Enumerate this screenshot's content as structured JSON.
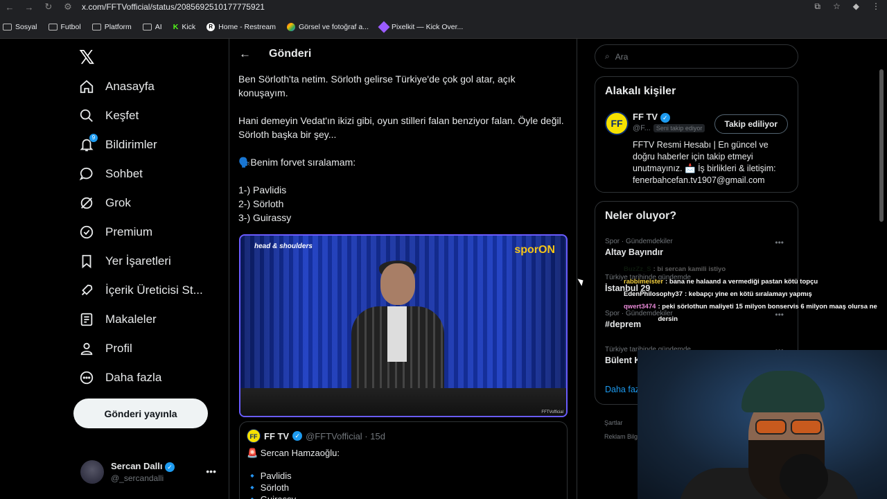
{
  "browser": {
    "url": "x.com/FFTVofficial/status/2085692510177775921",
    "bookmarks": [
      {
        "label": "Sosyal",
        "icon": "folder-icon"
      },
      {
        "label": "Futbol",
        "icon": "folder-icon"
      },
      {
        "label": "Platform",
        "icon": "folder-icon"
      },
      {
        "label": "AI",
        "icon": "folder-icon"
      },
      {
        "label": "Kick",
        "icon": "kick-icon"
      },
      {
        "label": "Home - Restream",
        "icon": "restream-icon"
      },
      {
        "label": "Görsel ve fotoğraf a...",
        "icon": "image-icon"
      },
      {
        "label": "Pixelkit — Kick Over...",
        "icon": "pixelkit-icon"
      }
    ]
  },
  "sidebar": {
    "items": [
      {
        "label": "Anasayfa",
        "icon": "home-icon"
      },
      {
        "label": "Keşfet",
        "icon": "search-icon"
      },
      {
        "label": "Bildirimler",
        "icon": "bell-icon",
        "badge": "9"
      },
      {
        "label": "Sohbet",
        "icon": "chat-icon"
      },
      {
        "label": "Grok",
        "icon": "grok-icon"
      },
      {
        "label": "Premium",
        "icon": "premium-icon"
      },
      {
        "label": "Yer İşaretleri",
        "icon": "bookmark-icon"
      },
      {
        "label": "İçerik Üreticisi St...",
        "icon": "rocket-icon"
      },
      {
        "label": "Makaleler",
        "icon": "article-icon"
      },
      {
        "label": "Profil",
        "icon": "profile-icon"
      },
      {
        "label": "Daha fazla",
        "icon": "more-circle-icon"
      }
    ],
    "post_button": "Gönderi yayınla",
    "account": {
      "name": "Sercan Dallı",
      "handle": "@_sercandalli"
    }
  },
  "main": {
    "title": "Gönderi",
    "paragraphs": [
      "Ben Sörloth'ta netim. Sörloth gelirse Türkiye'de çok gol atar, açık konuşayım.",
      "Hani demeyin Vedat'ın ikizi gibi, oyun stilleri falan benziyor falan. Öyle değil. Sörloth başka bir şey...",
      "🗣️Benim forvet sıralamam:"
    ],
    "ranking": [
      "1-) Pavlidis",
      "2-) Sörloth",
      "3-) Guirassy"
    ],
    "video": {
      "brand_left": "head & shoulders",
      "brand_right_a": "spor",
      "brand_right_b": "ON",
      "watermark": "FFTVofficial"
    },
    "quote": {
      "name": "FF TV",
      "handle": "@FFTVofficial · 15d",
      "text": "🚨 Sercan Hamzaoğlu:",
      "list": [
        "🔹 Pavlidis",
        "🔹 Sörloth",
        "🔹 Guirassy ..."
      ]
    }
  },
  "right": {
    "search_placeholder": "Ara",
    "related": {
      "title": "Alakalı kişiler",
      "name": "FF TV",
      "handle": "@F...",
      "follows_you": "Seni takip ediyor",
      "follow_btn": "Takip ediliyor",
      "bio": "FFTV Resmi Hesabı | En güncel ve doğru haberler için takip etmeyi unutmayınız. 📩 İş birlikleri & iletişim: fenerbahcefan.tv1907@gmail.com"
    },
    "trends": {
      "title": "Neler oluyor?",
      "items": [
        {
          "ctx": "Spor · Gündemdekiler",
          "title": "Altay Bayındır"
        },
        {
          "ctx": "Türkiye tarihinde gündemde",
          "title": "İstanbul 29"
        },
        {
          "ctx": "Spor · Gündemdekiler",
          "title": "#deprem"
        },
        {
          "ctx": "Türkiye tarihinde gündemde",
          "title": "Bülent K"
        }
      ],
      "more": "Daha faz"
    },
    "footer": [
      "Şartlar",
      "Reklam Bilgi"
    ]
  },
  "chat": [
    {
      "user": "BuzZz_S",
      "msg": ": bi sercan kamili istiyo",
      "faded": true
    },
    {
      "user": "rabbimeister",
      "msg": ": bana ne halaand a vermediği pastan kötü topçu",
      "faded": false
    },
    {
      "user": "EdenPhilosophy37",
      "msg": ": kebapçı yine en kötü sıralamayı yapmış",
      "faded": false
    },
    {
      "user": "qwert3474",
      "msg": ": peki sörlothun maliyeti 15 milyon bonservis 6 milyon maaş olursa ne dersin",
      "faded": false
    }
  ]
}
